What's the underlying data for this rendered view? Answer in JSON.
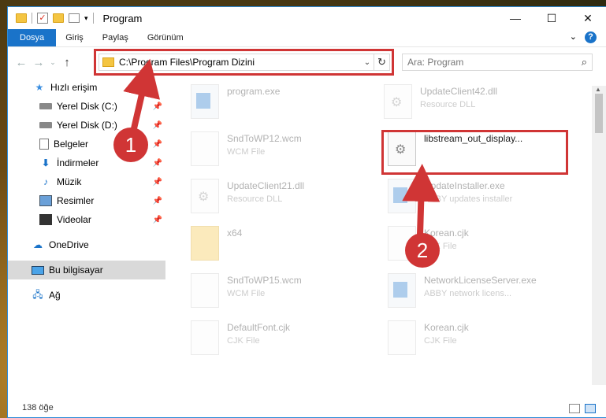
{
  "window": {
    "title": "Program"
  },
  "ribbon": {
    "tabs": [
      "Dosya",
      "Giriş",
      "Paylaş",
      "Görünüm"
    ]
  },
  "address": {
    "path": "C:\\Program Files\\Program Dizini"
  },
  "search": {
    "placeholder": "Ara: Program"
  },
  "sidebar": {
    "items": [
      {
        "label": "Hızlı erişim",
        "icon": "star-icon"
      },
      {
        "label": "Yerel Disk (C:)",
        "icon": "disk-icon"
      },
      {
        "label": "Yerel Disk (D:)",
        "icon": "disk-icon"
      },
      {
        "label": "Belgeler",
        "icon": "documents-icon"
      },
      {
        "label": "İndirmeler",
        "icon": "download-icon"
      },
      {
        "label": "Müzik",
        "icon": "music-icon"
      },
      {
        "label": "Resimler",
        "icon": "pictures-icon"
      },
      {
        "label": "Videolar",
        "icon": "videos-icon"
      },
      {
        "label": "OneDrive",
        "icon": "cloud-icon"
      },
      {
        "label": "Bu bilgisayar",
        "icon": "computer-icon"
      },
      {
        "label": "Ağ",
        "icon": "network-icon"
      }
    ]
  },
  "files": [
    {
      "name": "program.exe",
      "type": ""
    },
    {
      "name": "UpdateClient42.dll",
      "type": "Resource DLL"
    },
    {
      "name": "SndToWP12.wcm",
      "type": "WCM File"
    },
    {
      "name": "libstream_out_display...",
      "type": ""
    },
    {
      "name": "UpdateClient21.dll",
      "type": "Resource DLL"
    },
    {
      "name": "UpdateInstaller.exe",
      "type": "ABBY updates installer"
    },
    {
      "name": "x64",
      "type": ""
    },
    {
      "name": "Korean.cjk",
      "type": "CJK File"
    },
    {
      "name": "SndToWP15.wcm",
      "type": "WCM File"
    },
    {
      "name": "NetworkLicenseServer.exe",
      "type": "ABBY network licens..."
    },
    {
      "name": "DefaultFont.cjk",
      "type": "CJK File"
    },
    {
      "name": "Korean.cjk",
      "type": "CJK File"
    }
  ],
  "status": {
    "count": "138 öğe"
  },
  "annotations": {
    "one": "1",
    "two": "2"
  },
  "colors": {
    "accent": "#1a73c9",
    "highlight": "#d03535"
  }
}
